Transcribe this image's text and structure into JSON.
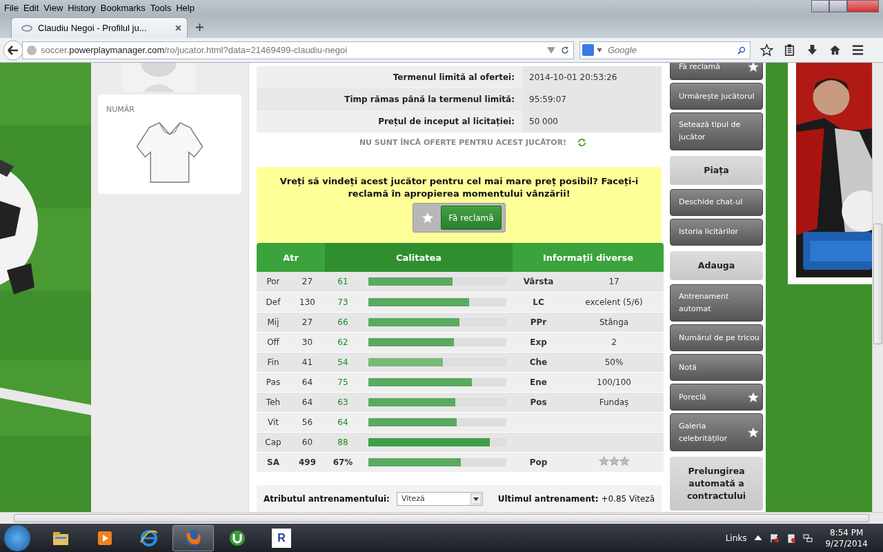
{
  "browser": {
    "menu": [
      "File",
      "Edit",
      "View",
      "History",
      "Bookmarks",
      "Tools",
      "Help"
    ],
    "tab_title": "Claudiu Negoi - Profilul ju...",
    "url": {
      "prefix": "soccer.",
      "domain": "powerplaymanager.com",
      "path": "/ro/jucator.html?data=21469499-claudiu-negoi"
    },
    "search": {
      "placeholder": "Google"
    }
  },
  "number_card": {
    "label": "NUMĂR"
  },
  "auction": [
    {
      "label": "Termenul limită al ofertei:",
      "value": "2014-10-01 20:53:26"
    },
    {
      "label": "Timp rămas până la termenul limită:",
      "value": "95:59:07"
    },
    {
      "label": "Prețul de inceput al licitației:",
      "value": "50 000"
    }
  ],
  "no_offers": "NU SUNT ÎNCĂ OFERTE PENTRU ACEST JUCĂTOR!",
  "promo": {
    "text": "Vreți să vindeți acest jucător pentru cel mai mare preț posibil? Faceți-i reclamă în apropierea momentului vânzării!",
    "button": "Fă reclamă"
  },
  "attributes": {
    "columns": [
      "Atr",
      "Calitatea",
      "Informații diverse"
    ],
    "rows": [
      {
        "name": "Por",
        "value": "27",
        "quality": "61",
        "level": 0.61,
        "info_label": "Vârsta",
        "info_value": "17"
      },
      {
        "name": "Def",
        "value": "130",
        "quality": "73",
        "level": 0.73,
        "info_label": "LC",
        "info_value": "excelent (5/6)"
      },
      {
        "name": "Mij",
        "value": "27",
        "quality": "66",
        "level": 0.66,
        "info_label": "PPr",
        "info_value": "Stânga"
      },
      {
        "name": "Off",
        "value": "30",
        "quality": "62",
        "level": 0.62,
        "info_label": "Exp",
        "info_value": "2"
      },
      {
        "name": "Fin",
        "value": "41",
        "quality": "54",
        "level": 0.54,
        "info_label": "Che",
        "info_value": "50%"
      },
      {
        "name": "Pas",
        "value": "64",
        "quality": "75",
        "level": 0.75,
        "info_label": "Ene",
        "info_value": "100/100"
      },
      {
        "name": "Teh",
        "value": "64",
        "quality": "63",
        "level": 0.63,
        "info_label": "Pos",
        "info_value": "Fundaș"
      },
      {
        "name": "Vit",
        "value": "56",
        "quality": "64",
        "level": 0.64
      },
      {
        "name": "Cap",
        "value": "60",
        "quality": "88",
        "level": 0.88
      }
    ],
    "summary": {
      "name": "SA",
      "value": "499",
      "quality": "67%",
      "level": 0.67,
      "info_label": "Pop",
      "stars": 0
    }
  },
  "training": {
    "label": "Atributul antrenamentului:",
    "select": "Viteză",
    "last_label": "Ultimul antrenament:",
    "last_value": "+0.85 Viteză"
  },
  "side_menu": [
    {
      "kind": "button",
      "label": "Fă reclamă",
      "star": true
    },
    {
      "kind": "button",
      "label": "Urmărește jucătorul",
      "star": false
    },
    {
      "kind": "button",
      "label": "Setează tipul de jucător",
      "star": false
    },
    {
      "kind": "header",
      "label": "Piața"
    },
    {
      "kind": "button",
      "label": "Deschide chat-ul",
      "star": false
    },
    {
      "kind": "button",
      "label": "Istoria licitărilor",
      "star": false
    },
    {
      "kind": "header",
      "label": "Adauga"
    },
    {
      "kind": "button",
      "label": "Antrenament automat",
      "star": false
    },
    {
      "kind": "button",
      "label": "Numărul de pe tricou",
      "star": false
    },
    {
      "kind": "button",
      "label": "Notă",
      "star": false
    },
    {
      "kind": "button",
      "label": "Poreclă",
      "star": true
    },
    {
      "kind": "button",
      "label": "Galeria celebrităților",
      "star": true
    },
    {
      "kind": "header",
      "label": "Prelungirea automată a contractului"
    }
  ],
  "taskbar": {
    "apps": [
      {
        "kind": "folder",
        "selected": false
      },
      {
        "kind": "media",
        "selected": false
      },
      {
        "kind": "ie",
        "selected": false
      },
      {
        "kind": "firefox",
        "selected": true
      },
      {
        "kind": "torrent",
        "selected": false
      },
      {
        "kind": "r",
        "label": "R",
        "selected": false
      }
    ],
    "links": "Links",
    "time": "8:54 PM",
    "date": "9/27/2014"
  }
}
